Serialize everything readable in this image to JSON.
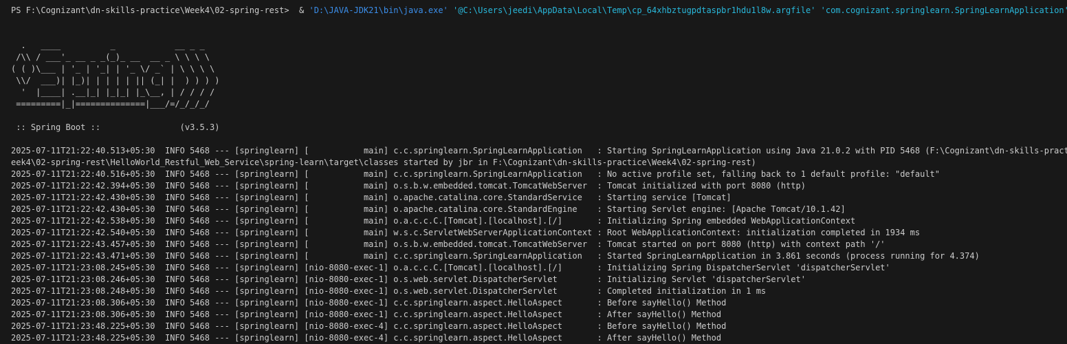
{
  "prompt": {
    "prefix": "PS F:\\Cognizant\\dn-skills-practice\\Week4\\02-spring-rest>  & ",
    "java_path": "'D:\\JAVA-JDK21\\bin\\java.exe'",
    "argfile": " '@C:\\Users\\jeedi\\AppData\\Local\\Temp\\cp_64xhbztugpdtaspbr1hdu1l8w.argfile'",
    "main_class": " 'com.cognizant.springlearn.SpringLearnApplication'"
  },
  "banner": [
    "  .   ____          _            __ _ _",
    " /\\\\ / ___'_ __ _ _(_)_ __  __ _ \\ \\ \\ \\",
    "( ( )\\___ | '_ | '_| | '_ \\/ _` | \\ \\ \\ \\",
    " \\\\/  ___)| |_)| | | | | || (_| |  ) ) ) )",
    "  '  |____| .__|_| |_|_| |_\\__, | / / / /",
    " =========|_|==============|___/=/_/_/_/"
  ],
  "boot_line": " :: Spring Boot ::                (v3.5.3)",
  "log_lines": [
    "2025-07-11T21:22:40.513+05:30  INFO 5468 --- [springlearn] [           main] c.c.springlearn.SpringLearnApplication   : Starting SpringLearnApplication using Java 21.0.2 with PID 5468 (F:\\Cognizant\\dn-skills-practice\\W",
    "eek4\\02-spring-rest\\HelloWorld_Restful_Web_Service\\spring-learn\\target\\classes started by jbr in F:\\Cognizant\\dn-skills-practice\\Week4\\02-spring-rest)",
    "2025-07-11T21:22:40.516+05:30  INFO 5468 --- [springlearn] [           main] c.c.springlearn.SpringLearnApplication   : No active profile set, falling back to 1 default profile: \"default\"",
    "2025-07-11T21:22:42.394+05:30  INFO 5468 --- [springlearn] [           main] o.s.b.w.embedded.tomcat.TomcatWebServer  : Tomcat initialized with port 8080 (http)",
    "2025-07-11T21:22:42.430+05:30  INFO 5468 --- [springlearn] [           main] o.apache.catalina.core.StandardService   : Starting service [Tomcat]",
    "2025-07-11T21:22:42.430+05:30  INFO 5468 --- [springlearn] [           main] o.apache.catalina.core.StandardEngine    : Starting Servlet engine: [Apache Tomcat/10.1.42]",
    "2025-07-11T21:22:42.538+05:30  INFO 5468 --- [springlearn] [           main] o.a.c.c.C.[Tomcat].[localhost].[/]       : Initializing Spring embedded WebApplicationContext",
    "2025-07-11T21:22:42.540+05:30  INFO 5468 --- [springlearn] [           main] w.s.c.ServletWebServerApplicationContext : Root WebApplicationContext: initialization completed in 1934 ms",
    "2025-07-11T21:22:43.457+05:30  INFO 5468 --- [springlearn] [           main] o.s.b.w.embedded.tomcat.TomcatWebServer  : Tomcat started on port 8080 (http) with context path '/'",
    "2025-07-11T21:22:43.471+05:30  INFO 5468 --- [springlearn] [           main] c.c.springlearn.SpringLearnApplication   : Started SpringLearnApplication in 3.861 seconds (process running for 4.374)",
    "2025-07-11T21:23:08.245+05:30  INFO 5468 --- [springlearn] [nio-8080-exec-1] o.a.c.c.C.[Tomcat].[localhost].[/]       : Initializing Spring DispatcherServlet 'dispatcherServlet'",
    "2025-07-11T21:23:08.246+05:30  INFO 5468 --- [springlearn] [nio-8080-exec-1] o.s.web.servlet.DispatcherServlet        : Initializing Servlet 'dispatcherServlet'",
    "2025-07-11T21:23:08.248+05:30  INFO 5468 --- [springlearn] [nio-8080-exec-1] o.s.web.servlet.DispatcherServlet        : Completed initialization in 1 ms",
    "2025-07-11T21:23:08.306+05:30  INFO 5468 --- [springlearn] [nio-8080-exec-1] c.c.springlearn.aspect.HelloAspect       : Before sayHello() Method",
    "2025-07-11T21:23:08.306+05:30  INFO 5468 --- [springlearn] [nio-8080-exec-1] c.c.springlearn.aspect.HelloAspect       : After sayHello() Method",
    "2025-07-11T21:23:48.225+05:30  INFO 5468 --- [springlearn] [nio-8080-exec-4] c.c.springlearn.aspect.HelloAspect       : Before sayHello() Method",
    "2025-07-11T21:23:48.225+05:30  INFO 5468 --- [springlearn] [nio-8080-exec-4] c.c.springlearn.aspect.HelloAspect       : After sayHello() Method"
  ],
  "colors": {
    "background": "#181818",
    "text": "#cccccc",
    "path": "#3b8eea",
    "argument": "#29b8db"
  }
}
